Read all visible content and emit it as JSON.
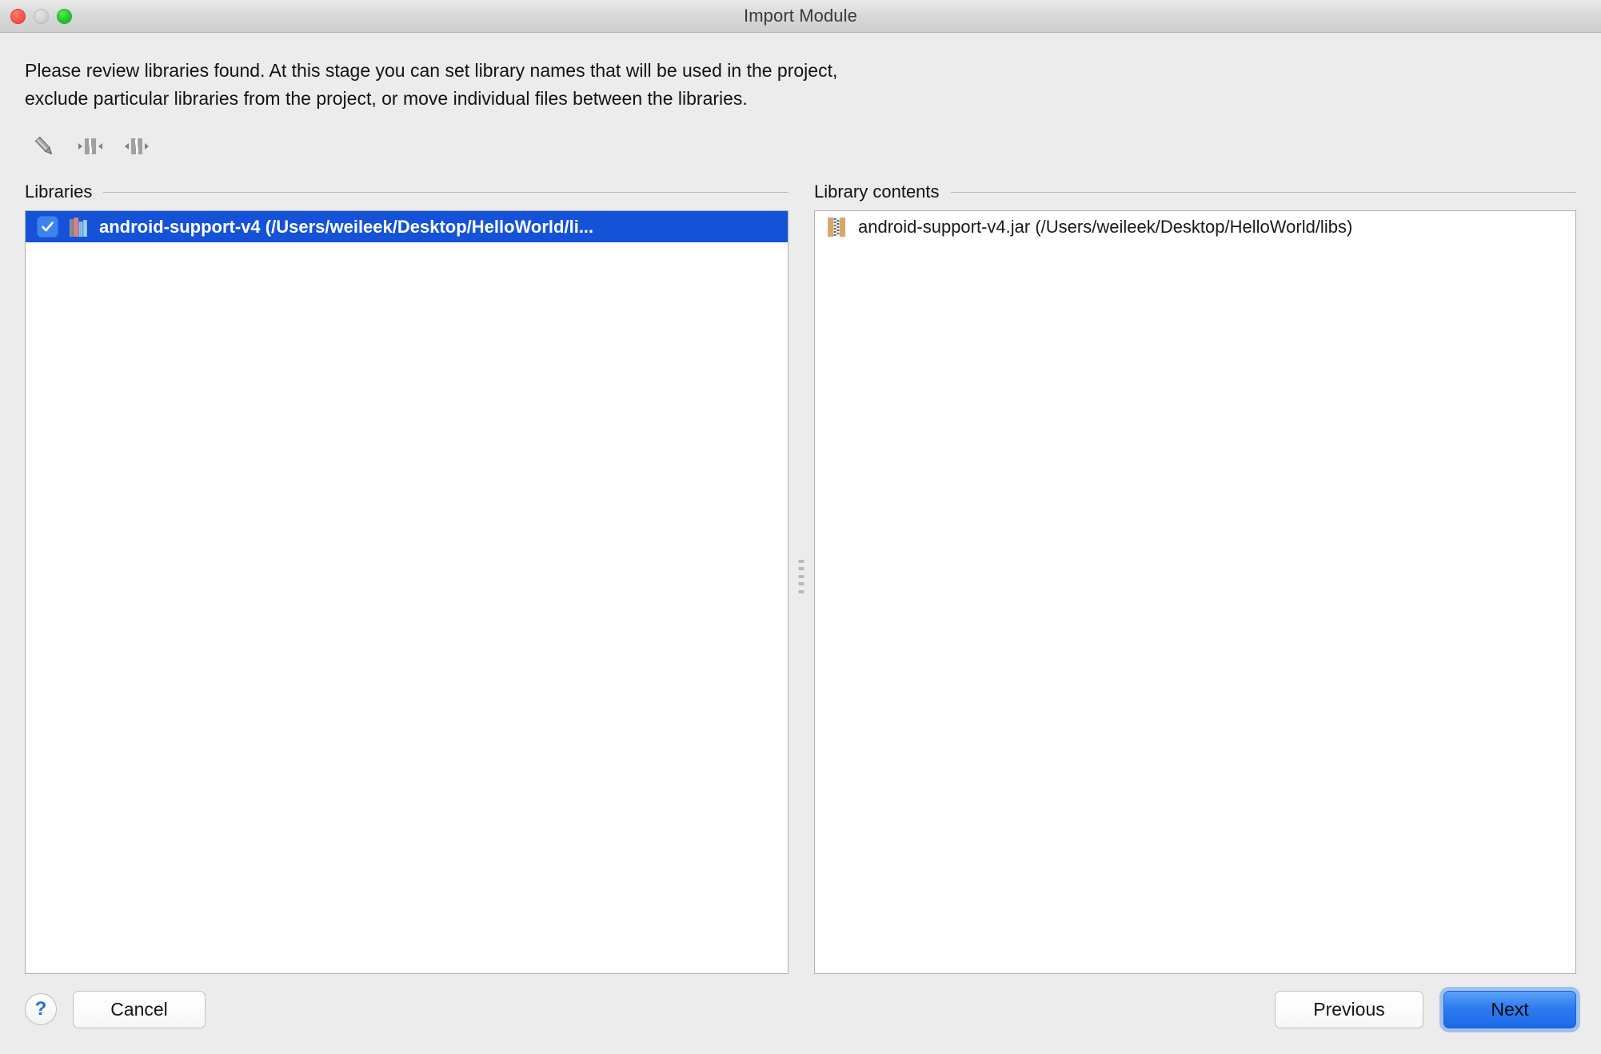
{
  "window": {
    "title": "Import Module",
    "traffic_lights": [
      {
        "name": "close",
        "color": "#fb5b52"
      },
      {
        "name": "minimize",
        "color": "#d4d4d4"
      },
      {
        "name": "maximize",
        "color": "#25cc28"
      }
    ]
  },
  "description": {
    "line1": "Please review libraries found. At this stage you can set library names that will be used in the project,",
    "line2": "exclude particular libraries from the project, or move individual files between the libraries."
  },
  "toolbar": {
    "items": [
      {
        "icon": "pencil-icon",
        "tooltip": "Rename library"
      },
      {
        "icon": "merge-icon",
        "tooltip": "Merge libraries"
      },
      {
        "icon": "split-icon",
        "tooltip": "Split library"
      }
    ]
  },
  "left_pane": {
    "label": "Libraries",
    "rows": [
      {
        "checked": true,
        "icon": "library-books-icon",
        "label": "android-support-v4 (/Users/weileek/Desktop/HelloWorld/li...",
        "selected": true
      }
    ]
  },
  "right_pane": {
    "label": "Library contents",
    "rows": [
      {
        "icon": "jar-file-icon",
        "label": "android-support-v4.jar (/Users/weileek/Desktop/HelloWorld/libs)",
        "selected": false
      }
    ]
  },
  "footer": {
    "help_label": "?",
    "cancel_label": "Cancel",
    "previous_label": "Previous",
    "next_label": "Next"
  },
  "colors": {
    "selection_blue": "#1452d8",
    "primary_button_blue": "#2f7cf0",
    "window_bg": "#ececec",
    "help_blue": "#1a6fe0"
  }
}
